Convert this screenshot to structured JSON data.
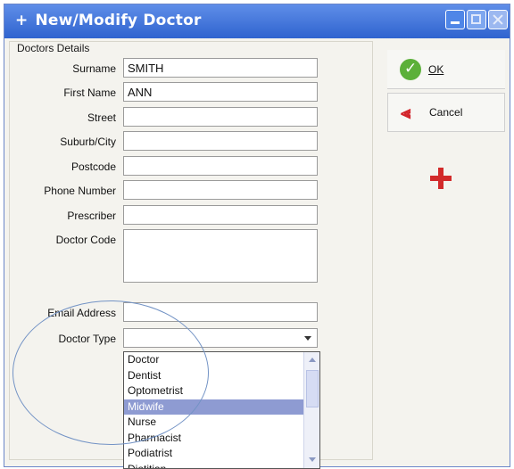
{
  "window": {
    "title": "New/Modify Doctor",
    "title_icon": "plus"
  },
  "group": {
    "label": "Doctors Details"
  },
  "fields": [
    {
      "label": "Surname",
      "value": "SMITH"
    },
    {
      "label": "First Name",
      "value": "ANN"
    },
    {
      "label": "Street",
      "value": ""
    },
    {
      "label": "Suburb/City",
      "value": ""
    },
    {
      "label": "Postcode",
      "value": ""
    },
    {
      "label": "Phone Number",
      "value": ""
    },
    {
      "label": "Prescriber",
      "value": ""
    },
    {
      "label": "Doctor Code",
      "value": ""
    }
  ],
  "email": {
    "label": "Email Address",
    "value": ""
  },
  "doctor_type": {
    "label": "Doctor Type",
    "value": "",
    "options": [
      "Doctor",
      "Dentist",
      "Optometrist",
      "Midwife",
      "Nurse",
      "Pharmacist",
      "Podiatrist",
      "Dietitian"
    ],
    "selected": "Midwife"
  },
  "buttons": {
    "ok": "OK",
    "cancel": "Cancel"
  },
  "colors": {
    "accent": "#2f63cf",
    "selection": "#8e9bd2",
    "ok_green": "#5cb03a",
    "cancel_red": "#d2252b"
  }
}
